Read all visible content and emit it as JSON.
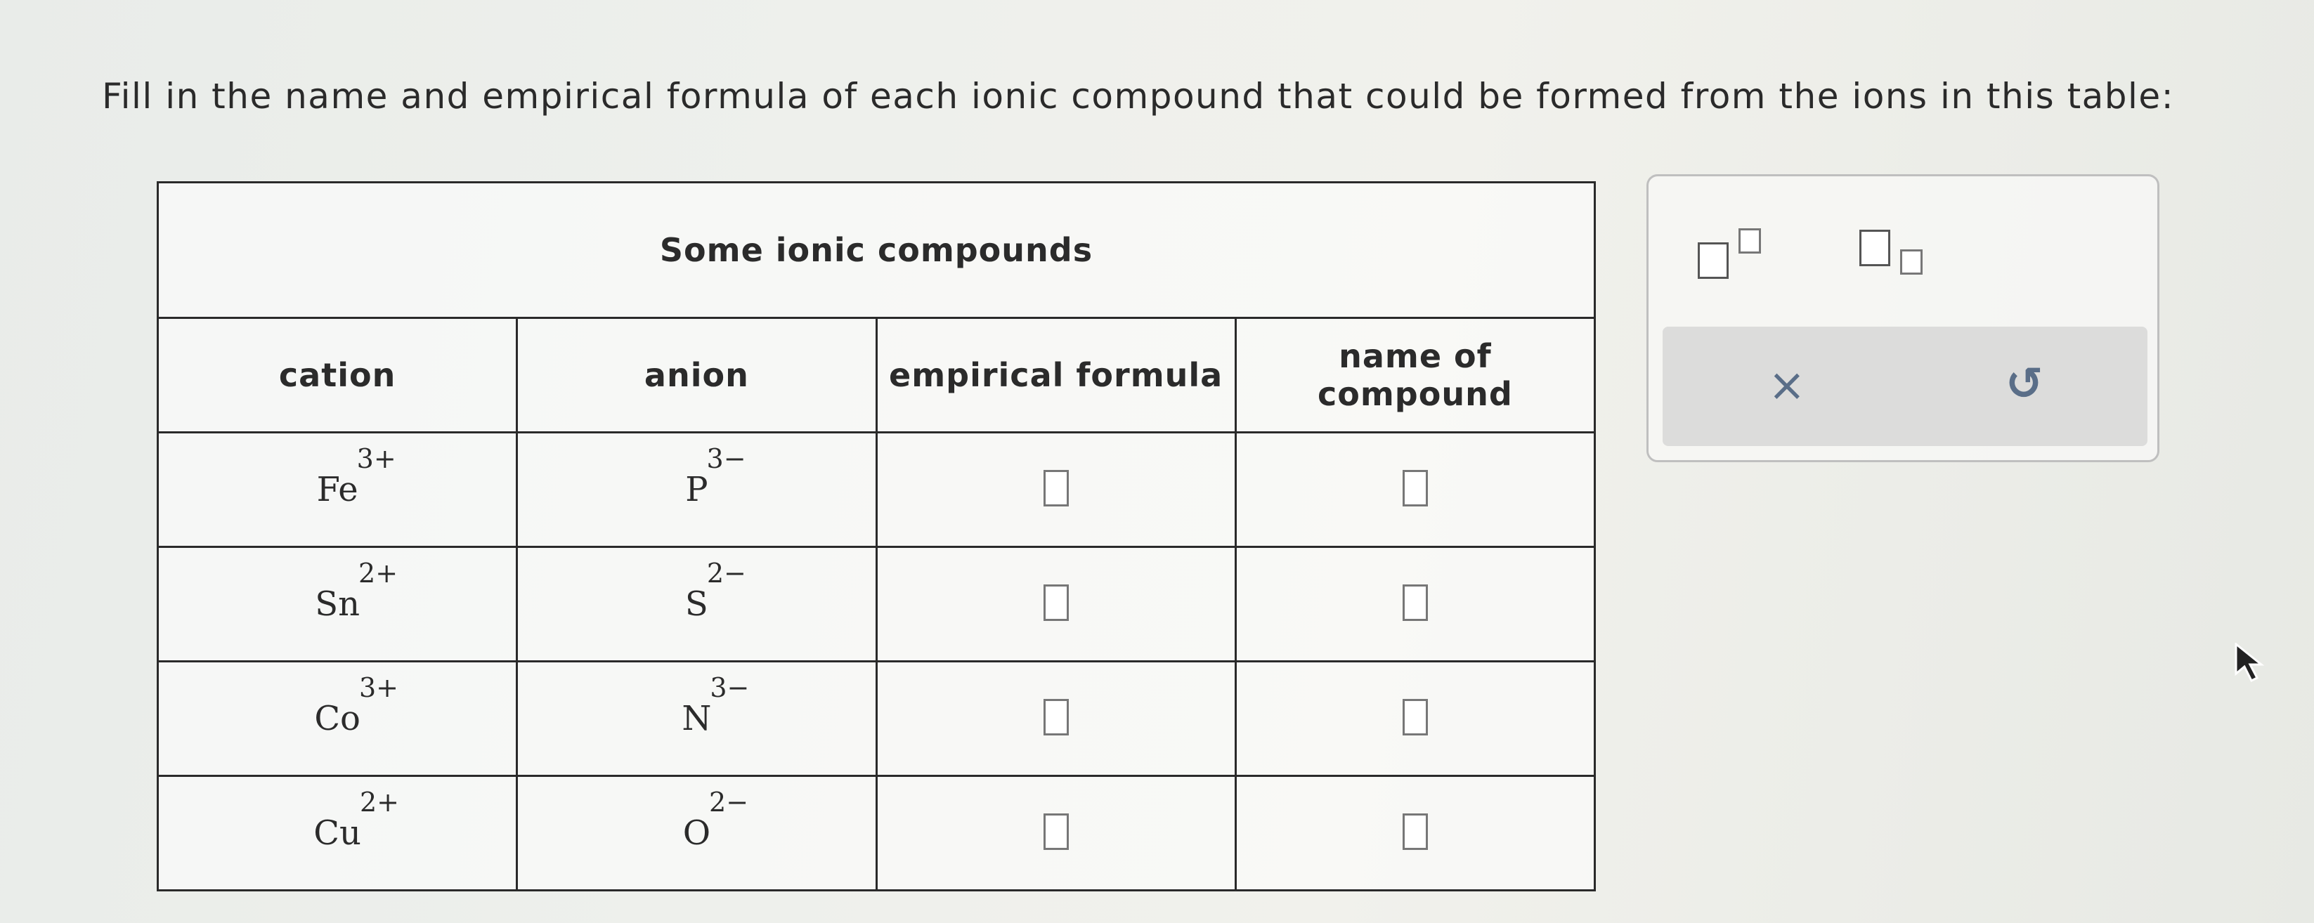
{
  "instructions": "Fill in the name and empirical formula of each ionic compound that could be formed from the ions in this table:",
  "table": {
    "caption": "Some ionic compounds",
    "headers": [
      "cation",
      "anion",
      "empirical formula",
      "name of compound"
    ],
    "rows": [
      {
        "cation": {
          "symbol": "Fe",
          "charge": "3+"
        },
        "anion": {
          "symbol": "P",
          "charge": "3−"
        },
        "formula": "",
        "name": ""
      },
      {
        "cation": {
          "symbol": "Sn",
          "charge": "2+"
        },
        "anion": {
          "symbol": "S",
          "charge": "2−"
        },
        "formula": "",
        "name": ""
      },
      {
        "cation": {
          "symbol": "Co",
          "charge": "3+"
        },
        "anion": {
          "symbol": "N",
          "charge": "3−"
        },
        "formula": "",
        "name": ""
      },
      {
        "cation": {
          "symbol": "Cu",
          "charge": "2+"
        },
        "anion": {
          "symbol": "O",
          "charge": "2−"
        },
        "formula": "",
        "name": ""
      }
    ]
  },
  "palette": {
    "buttons": [
      "superscript-template",
      "subscript-template"
    ],
    "tools": [
      {
        "name": "clear",
        "glyph": "×"
      },
      {
        "name": "undo",
        "glyph": "↺"
      }
    ]
  },
  "colors": {
    "icon": "#5a6e88",
    "border": "#2a2a2a"
  }
}
